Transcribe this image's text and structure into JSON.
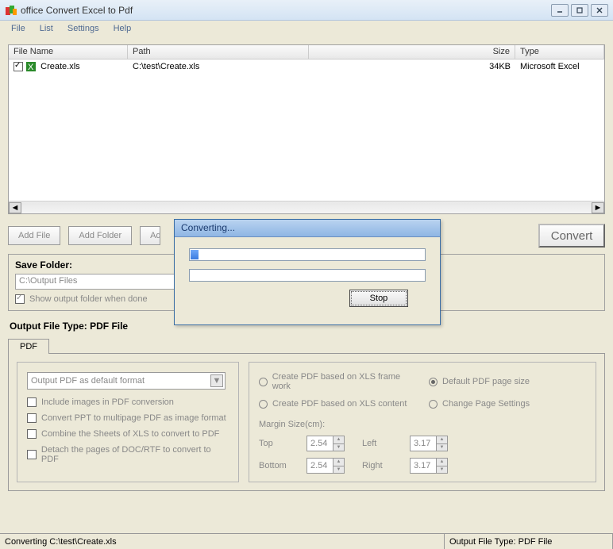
{
  "title": "office Convert Excel to Pdf",
  "menu": {
    "file": "File",
    "list": "List",
    "settings": "Settings",
    "help": "Help"
  },
  "table": {
    "cols": {
      "name": "File Name",
      "path": "Path",
      "size": "Size",
      "type": "Type"
    },
    "row": {
      "name": "Create.xls",
      "path": "C:\\test\\Create.xls",
      "size": "34KB",
      "type": "Microsoft Excel"
    }
  },
  "buttons": {
    "addfile": "Add File",
    "addfolder": "Add Folder",
    "addpartial": "Ad",
    "convert": "Convert"
  },
  "save": {
    "legend": "Save Folder:",
    "path": "C:\\Output Files",
    "showWhenDone": "Show output folder when done"
  },
  "outputTypeLabel": "Output File Type:  PDF File",
  "tab": "PDF",
  "leftOpts": {
    "combo": "Output PDF as default format",
    "c1": "Include images in PDF conversion",
    "c2": "Convert PPT to multipage PDF as image format",
    "c3": "Combine the Sheets of XLS to convert to PDF",
    "c4": "Detach the pages of DOC/RTF to convert to PDF"
  },
  "rightOpts": {
    "r1": "Create PDF based on XLS frame work",
    "r2": "Default PDF page size",
    "r3": "Create PDF based on XLS content",
    "r4": "Change Page Settings",
    "marginLabel": "Margin Size(cm):",
    "top": "Top",
    "bottom": "Bottom",
    "left": "Left",
    "right": "Right",
    "v_tb": "2.54",
    "v_lr": "3.17"
  },
  "status": {
    "left": "Converting  C:\\test\\Create.xls",
    "right": "Output File Type:  PDF File"
  },
  "dialog": {
    "title": "Converting...",
    "stop": "Stop"
  }
}
